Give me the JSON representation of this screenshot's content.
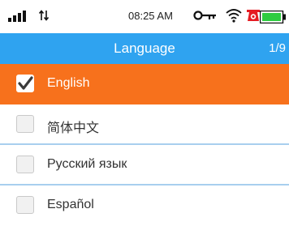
{
  "status_bar": {
    "time": "08:25 AM",
    "icons": [
      "signal-icon",
      "data-transfer-icon",
      "key-icon",
      "wifi-icon",
      "alarm-icon",
      "battery-icon"
    ]
  },
  "header": {
    "title": "Language",
    "page_indicator": "1/9",
    "background_color": "#2fa3f0"
  },
  "languages": [
    {
      "label": "English",
      "checked": true
    },
    {
      "label": "简体中文",
      "checked": false
    },
    {
      "label": "Русский язык",
      "checked": false
    },
    {
      "label": "Español",
      "checked": false
    }
  ],
  "colors": {
    "selected_row": "#f7711c",
    "divider": "#a8cfee"
  }
}
